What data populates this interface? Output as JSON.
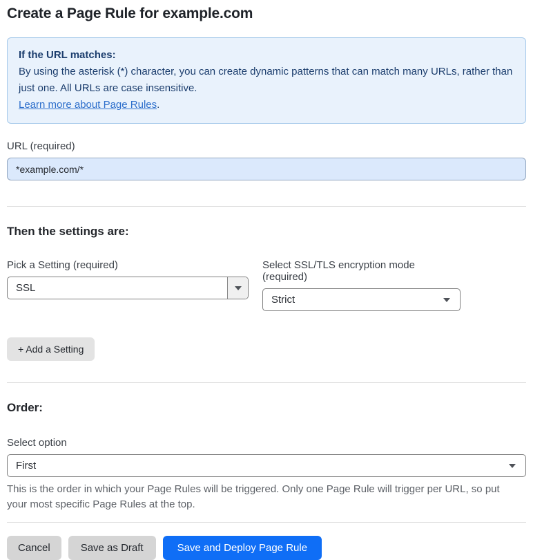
{
  "page": {
    "title": "Create a Page Rule for example.com"
  },
  "info_box": {
    "heading": "If the URL matches:",
    "body": "By using the asterisk (*) character, you can create dynamic patterns that can match many URLs, rather than just one. All URLs are case insensitive.",
    "link_label": "Learn more about Page Rules",
    "link_suffix": "."
  },
  "url_field": {
    "label": "URL (required)",
    "value": "*example.com/*"
  },
  "settings_section": {
    "heading": "Then the settings are:",
    "setting_select": {
      "label": "Pick a Setting (required)",
      "value": "SSL"
    },
    "mode_select": {
      "label": "Select SSL/TLS encryption mode (required)",
      "value": "Strict"
    },
    "add_setting_label": "+ Add a Setting"
  },
  "order_section": {
    "heading": "Order:",
    "select_label": "Select option",
    "select_value": "First",
    "help_text": "This is the order in which your Page Rules will be triggered. Only one Page Rule will trigger per URL, so put your most specific Page Rules at the top."
  },
  "footer": {
    "cancel_label": "Cancel",
    "save_draft_label": "Save as Draft",
    "save_deploy_label": "Save and Deploy Page Rule"
  },
  "icons": {
    "dropdown_arrow": "caret-down-icon"
  },
  "colors": {
    "accent_blue": "#0f6ef6",
    "info_bg": "#e9f2fc",
    "info_border": "#a5c9ea",
    "info_text": "#1b3d6d",
    "link_blue": "#2c6ecb",
    "url_input_bg": "#dbe9fc",
    "divider": "#dddddd",
    "gray_button_bg": "#d5d5d5",
    "add_setting_bg": "#e3e3e3"
  }
}
